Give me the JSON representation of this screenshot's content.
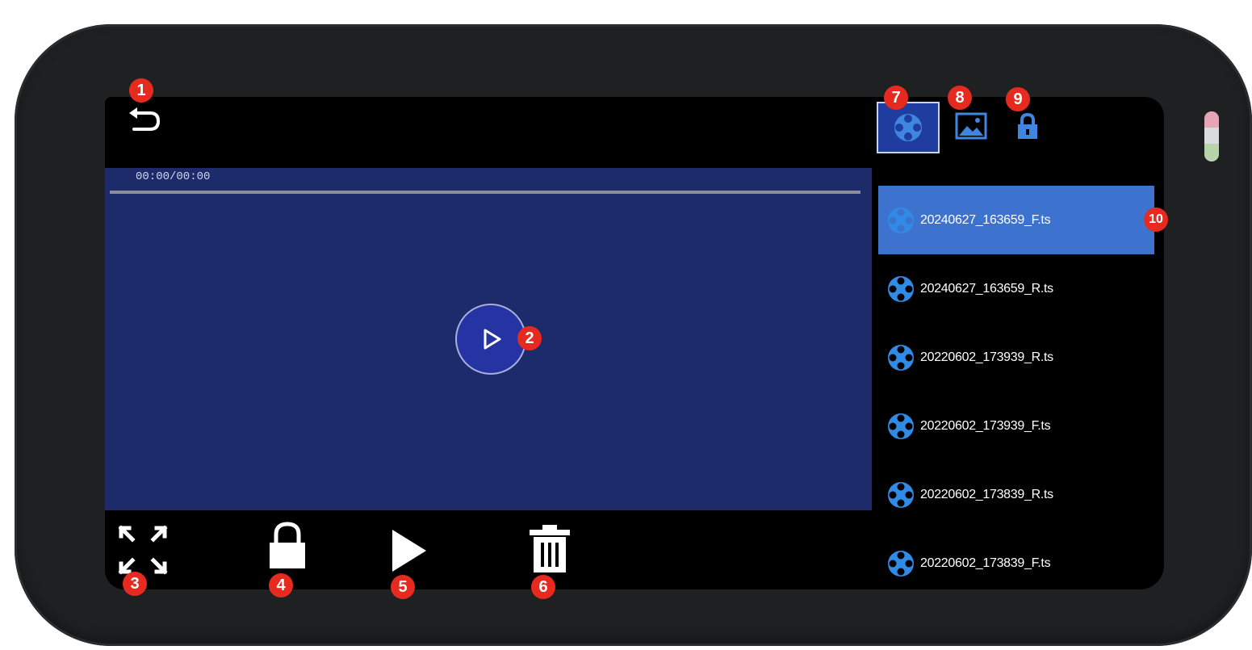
{
  "player": {
    "time": "00:00/00:00",
    "progress": 0
  },
  "tabs": [
    {
      "id": "video",
      "icon": "video-reel-icon",
      "active": true
    },
    {
      "id": "photo",
      "icon": "image-icon",
      "active": false
    },
    {
      "id": "locked",
      "icon": "lock-icon",
      "active": false
    }
  ],
  "files": [
    {
      "name": "20240627_163659_F.ts",
      "selected": true
    },
    {
      "name": "20240627_163659_R.ts",
      "selected": false
    },
    {
      "name": "20220602_173939_R.ts",
      "selected": false
    },
    {
      "name": "20220602_173939_F.ts",
      "selected": false
    },
    {
      "name": "20220602_173839_R.ts",
      "selected": false
    },
    {
      "name": "20220602_173839_F.ts",
      "selected": false
    }
  ],
  "callouts": {
    "back": "1",
    "play_center": "2",
    "fullscreen": "3",
    "lock": "4",
    "play": "5",
    "delete": "6",
    "tab_video": "7",
    "tab_photo": "8",
    "tab_locked": "9",
    "file_list": "10"
  },
  "colors": {
    "video_bg": "#1d2b6a",
    "accent_selected": "#3d73cf",
    "callout_red": "#e62a20",
    "bezel": "#1f2021"
  }
}
